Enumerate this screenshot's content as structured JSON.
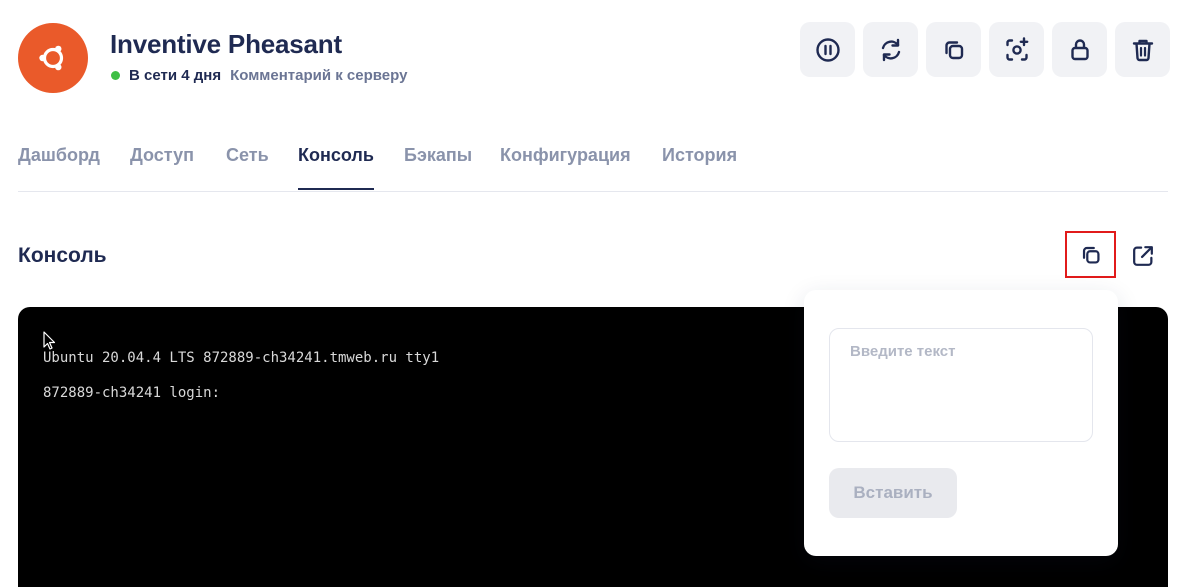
{
  "server": {
    "name": "Inventive Pheasant",
    "status": "В сети 4 дня",
    "comment_link": "Комментарий к серверу",
    "avatar_icon": "ubuntu-logo-icon",
    "status_color": "#3fbf45",
    "brand_color": "#ea5a2a"
  },
  "actions": [
    {
      "icon": "pause-icon"
    },
    {
      "icon": "reload-icon"
    },
    {
      "icon": "copy-icon"
    },
    {
      "icon": "snapshot-icon"
    },
    {
      "icon": "lock-icon"
    },
    {
      "icon": "trash-icon"
    }
  ],
  "tabs": [
    {
      "label": "Дашборд"
    },
    {
      "label": "Доступ"
    },
    {
      "label": "Сеть"
    },
    {
      "label": "Консоль",
      "active": true
    },
    {
      "label": "Бэкапы"
    },
    {
      "label": "Конфигурация"
    },
    {
      "label": "История"
    }
  ],
  "console_section": {
    "title": "Консоль",
    "lines": [
      "Ubuntu 20.04.4 LTS 872889-ch34241.tmweb.ru tty1",
      "872889-ch34241 login:"
    ]
  },
  "paste_popover": {
    "placeholder": "Введите текст",
    "submit_label": "Вставить"
  }
}
